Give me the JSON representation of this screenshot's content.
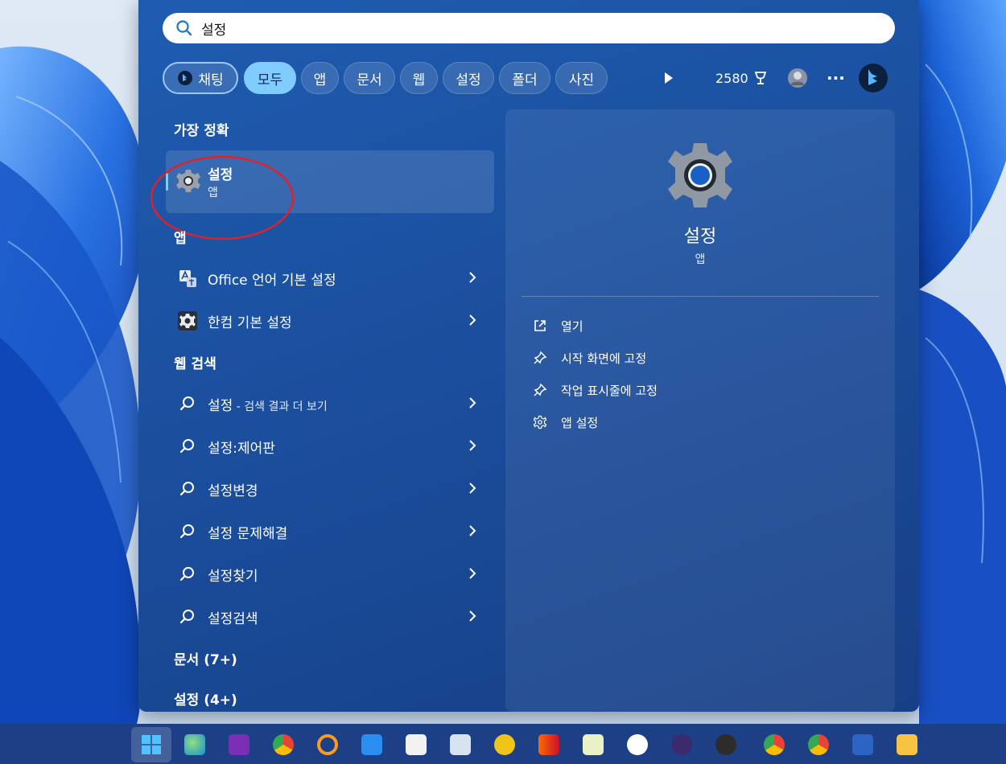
{
  "search": {
    "value": "설정",
    "icon": "search-icon"
  },
  "tabs": [
    {
      "label": "채팅",
      "icon": "bing-chat-icon"
    },
    {
      "label": "모두"
    },
    {
      "label": "앱"
    },
    {
      "label": "문서"
    },
    {
      "label": "웹"
    },
    {
      "label": "설정"
    },
    {
      "label": "폴더"
    },
    {
      "label": "사진"
    }
  ],
  "top_right": {
    "points": "2580",
    "points_icon": "rewards-icon",
    "more": "···"
  },
  "sections": {
    "best_match": "가장 정확",
    "apps": "앱",
    "web_search": "웹 검색",
    "documents": "문서 (7+)",
    "settings": "설정 (4+)"
  },
  "best_match": {
    "title": "설정",
    "subtitle": "앱",
    "icon": "settings-gear-icon"
  },
  "apps": [
    {
      "label": "Office 언어 기본 설정",
      "icon": "office-language-icon"
    },
    {
      "label": "한컴 기본 설정",
      "icon": "hancom-settings-icon"
    }
  ],
  "web_results": [
    {
      "label": "설정",
      "suffix": " - 검색 결과 더 보기"
    },
    {
      "label": "설정:제어판",
      "suffix": ""
    },
    {
      "label": "설정변경",
      "suffix": ""
    },
    {
      "label": "설정 문제해결",
      "suffix": ""
    },
    {
      "label": "설정찾기",
      "suffix": ""
    },
    {
      "label": "설정검색",
      "suffix": ""
    }
  ],
  "detail": {
    "title": "설정",
    "subtitle": "앱",
    "actions": [
      {
        "label": "열기",
        "icon": "open-external-icon"
      },
      {
        "label": "시작 화면에 고정",
        "icon": "pin-icon"
      },
      {
        "label": "작업 표시줄에 고정",
        "icon": "pin-icon"
      },
      {
        "label": "앱 설정",
        "icon": "gear-icon"
      }
    ]
  },
  "colors": {
    "panel": "#1b4f9e",
    "active_tab": "#80cbff",
    "annotation": "#e0202a",
    "taskbar": "#1c3f86"
  },
  "taskbar_icons": [
    "windows-start-icon",
    "edge-icon",
    "onenote-icon",
    "chrome-icon",
    "search-magnifier-icon",
    "vscode-icon",
    "app-icon",
    "hwp-icon",
    "app-icon",
    "app-icon",
    "notepad-icon",
    "app-icon",
    "app-icon",
    "obs-icon",
    "chrome-icon",
    "chrome-icon",
    "word-icon",
    "file-explorer-icon"
  ]
}
